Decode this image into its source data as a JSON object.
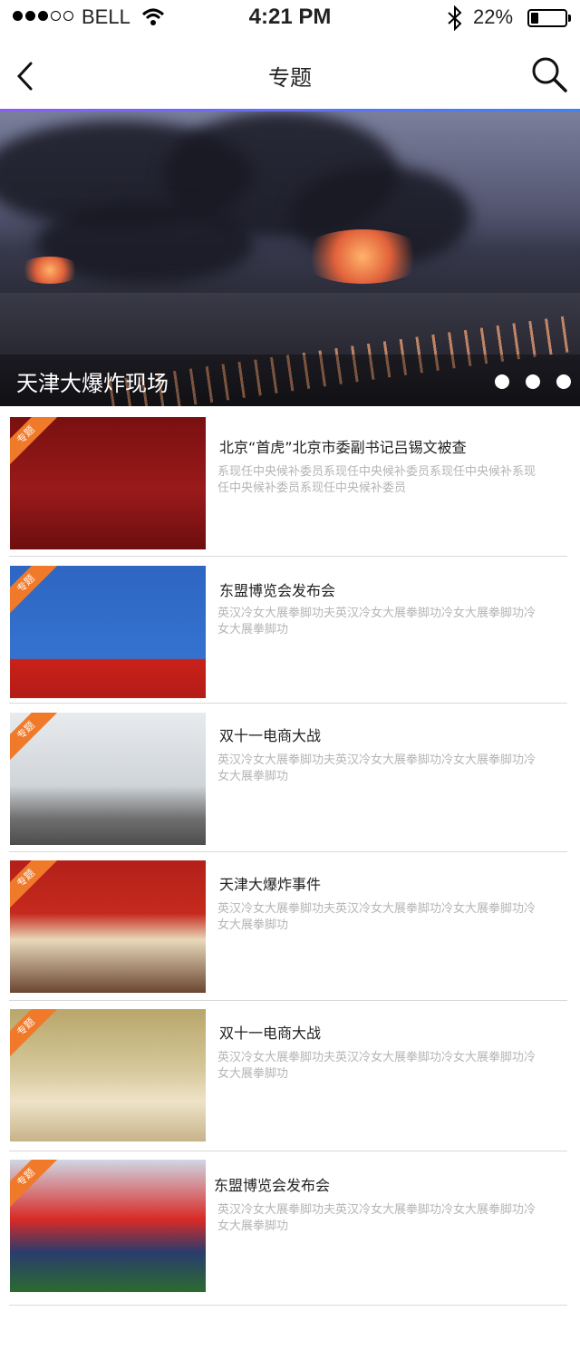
{
  "status_bar": {
    "carrier": "BELL",
    "time": "4:21 PM",
    "battery": "22%",
    "battery_level": 0.22,
    "signal_bars": 3,
    "signal_total": 5
  },
  "nav": {
    "title": "专题",
    "back_icon": "chevron-left-icon",
    "search_icon": "search-icon"
  },
  "banner": {
    "caption": "天津大爆炸现场",
    "page_count": 3,
    "accent_line": [
      "#8b5cf6",
      "#3b82f6"
    ]
  },
  "news": [
    {
      "tag": "专题",
      "title": "北京“首虎”北京市委副书记吕锡文被查",
      "desc": "系现任中央候补委员系现任中央候补委员系现任中央候补系现任中央候补委员系现任中央候补委员"
    },
    {
      "tag": "专题",
      "title": "东盟博览会发布会",
      "desc": "英汉冷女大展拳脚功夫英汉冷女大展拳脚功冷女大展拳脚功冷女大展拳脚功"
    },
    {
      "tag": "专题",
      "title": "双十一电商大战",
      "desc": "英汉冷女大展拳脚功夫英汉冷女大展拳脚功冷女大展拳脚功冷女大展拳脚功"
    },
    {
      "tag": "专题",
      "title": "天津大爆炸事件",
      "desc": "英汉冷女大展拳脚功夫英汉冷女大展拳脚功冷女大展拳脚功冷女大展拳脚功"
    },
    {
      "tag": "专题",
      "title": "双十一电商大战",
      "desc": "英汉冷女大展拳脚功夫英汉冷女大展拳脚功冷女大展拳脚功冷女大展拳脚功"
    },
    {
      "tag": "专题",
      "title": "东盟博览会发布会",
      "desc": "英汉冷女大展拳脚功夫英汉冷女大展拳脚功冷女大展拳脚功冷女大展拳脚功"
    }
  ]
}
